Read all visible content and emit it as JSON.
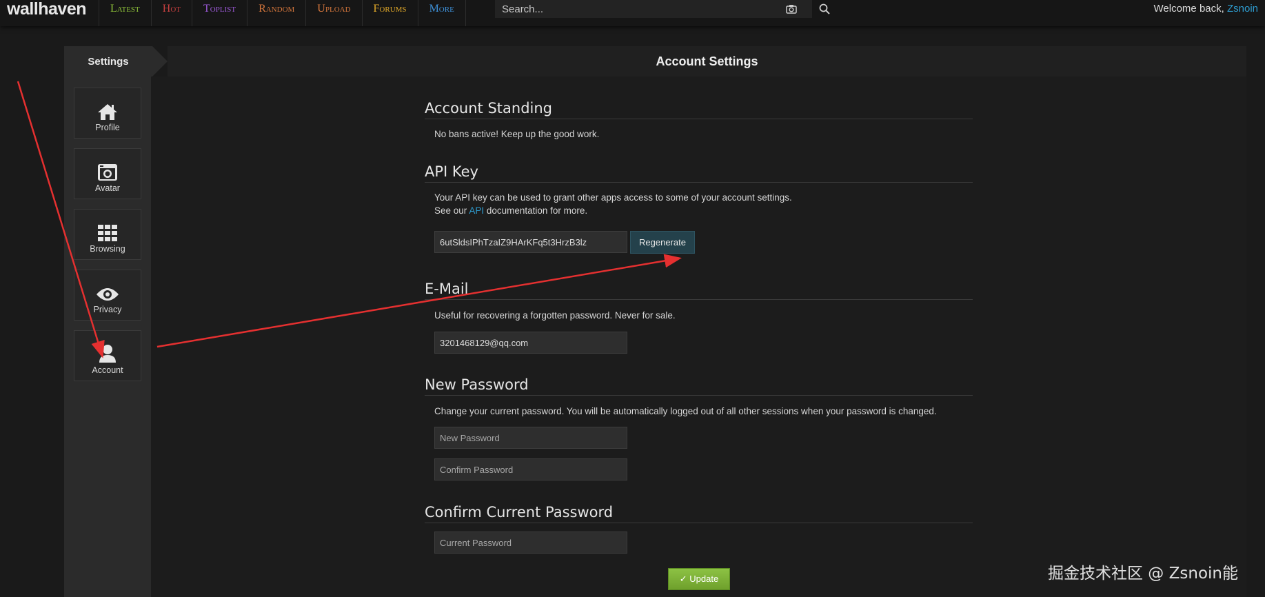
{
  "topbar": {
    "logo": "wallhaven",
    "nav": [
      {
        "label": "Latest",
        "color": "#8fc33a"
      },
      {
        "label": "Hot",
        "color": "#c43f3f"
      },
      {
        "label": "Toplist",
        "color": "#9b59d6"
      },
      {
        "label": "Random",
        "color": "#d4763c"
      },
      {
        "label": "Upload",
        "color": "#d4763c"
      },
      {
        "label": "Forums",
        "color": "#e0a829"
      },
      {
        "label": "More",
        "color": "#3d8fd6"
      }
    ],
    "search_placeholder": "Search...",
    "welcome": "Welcome back,",
    "username": "Zsnoin"
  },
  "sidebar": {
    "title": "Settings",
    "items": [
      {
        "label": "Profile",
        "icon": "home-icon"
      },
      {
        "label": "Avatar",
        "icon": "camera-icon"
      },
      {
        "label": "Browsing",
        "icon": "grid-icon"
      },
      {
        "label": "Privacy",
        "icon": "eye-icon"
      },
      {
        "label": "Account",
        "icon": "user-icon"
      }
    ]
  },
  "main": {
    "title": "Account Settings",
    "standing": {
      "heading": "Account Standing",
      "text": "No bans active! Keep up the good work."
    },
    "api": {
      "heading": "API Key",
      "line1": "Your API key can be used to grant other apps access to some of your account settings.",
      "line2_pre": "See our",
      "line2_link": "API",
      "line2_post": "documentation for more.",
      "key": "6utSldsIPhTzaIZ9HArKFq5t3HrzB3lz",
      "regenerate_label": "Regenerate"
    },
    "email": {
      "heading": "E-Mail",
      "text": "Useful for recovering a forgotten password. Never for sale.",
      "value": "3201468129@qq.com"
    },
    "new_password": {
      "heading": "New Password",
      "text": "Change your current password. You will be automatically logged out of all other sessions when your password is changed.",
      "new_placeholder": "New Password",
      "confirm_placeholder": "Confirm Password"
    },
    "current_password": {
      "heading": "Confirm Current Password",
      "placeholder": "Current Password"
    },
    "update_label": "✓ Update"
  },
  "watermark": "掘金技术社区 @ Zsnoin能",
  "colors": {
    "accent_link": "#2e9ccf",
    "annotation_arrow": "#e53030",
    "update_green": "#7ab236"
  }
}
